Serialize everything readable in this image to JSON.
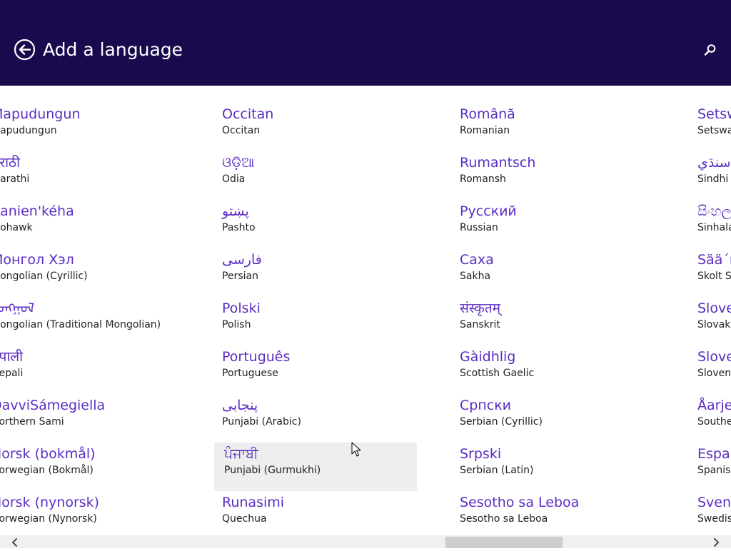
{
  "header": {
    "title": "Add a language",
    "back_icon": "back-arrow-icon",
    "search_icon": "search-icon",
    "background": "#180a4d"
  },
  "accent_color": "#5b2dc3",
  "columns": [
    {
      "items": [
        {
          "native": "Mapudungun",
          "english": "Mapudungun"
        },
        {
          "native": "मराठी",
          "english": "Marathi"
        },
        {
          "native": "Kanien'kéha",
          "english": "Mohawk"
        },
        {
          "native": "Монгол Хэл",
          "english": "Mongolian (Cyrillic)"
        },
        {
          "native": "ᠮᠣᠩᠭᠣᠯ",
          "english": "Mongolian (Traditional Mongolian)"
        },
        {
          "native": "नेपाली",
          "english": "Nepali"
        },
        {
          "native": "DavviSámegiella",
          "english": "Northern Sami"
        },
        {
          "native": "Norsk (bokmål)",
          "english": "Norwegian (Bokmål)"
        },
        {
          "native": "Norsk (nynorsk)",
          "english": "Norwegian (Nynorsk)"
        }
      ]
    },
    {
      "items": [
        {
          "native": "Occitan",
          "english": "Occitan"
        },
        {
          "native": "ଓଡ଼ିଆ",
          "english": "Odia"
        },
        {
          "native": "پښتو",
          "english": "Pashto"
        },
        {
          "native": "فارسى",
          "english": "Persian"
        },
        {
          "native": "Polski",
          "english": "Polish"
        },
        {
          "native": "Português",
          "english": "Portuguese"
        },
        {
          "native": "پنجابی",
          "english": "Punjabi (Arabic)"
        },
        {
          "native": "ਪੰਜਾਬੀ",
          "english": "Punjabi (Gurmukhi)"
        },
        {
          "native": "Runasimi",
          "english": "Quechua"
        }
      ]
    },
    {
      "items": [
        {
          "native": "Română",
          "english": "Romanian"
        },
        {
          "native": "Rumantsch",
          "english": "Romansh"
        },
        {
          "native": "Русский",
          "english": "Russian"
        },
        {
          "native": "Саха",
          "english": "Sakha"
        },
        {
          "native": "संस्कृतम्",
          "english": "Sanskrit"
        },
        {
          "native": "Gàidhlig",
          "english": "Scottish Gaelic"
        },
        {
          "native": "Српски",
          "english": "Serbian (Cyrillic)"
        },
        {
          "native": "Srpski",
          "english": "Serbian (Latin)"
        },
        {
          "native": "Sesotho sa Leboa",
          "english": "Sesotho sa Leboa"
        }
      ]
    },
    {
      "items": [
        {
          "native": "Setswana",
          "english": "Setswana"
        },
        {
          "native": "سنڌي",
          "english": "Sindhi (Arabic)"
        },
        {
          "native": "සිංහල",
          "english": "Sinhala"
        },
        {
          "native": "Sää´mǩiõll",
          "english": "Skolt Sami"
        },
        {
          "native": "Slovenčina",
          "english": "Slovak"
        },
        {
          "native": "Slovenski",
          "english": "Slovenian"
        },
        {
          "native": "Åarjelsaemiengiele",
          "english": "Southern Sami"
        },
        {
          "native": "Español",
          "english": "Spanish"
        },
        {
          "native": "Svenska",
          "english": "Swedish"
        }
      ]
    }
  ],
  "hovered_item": "Punjabi (Gurmukhi)",
  "scrollbar": {
    "left_icon": "chevron-left-icon",
    "right_icon": "chevron-right-icon",
    "position": 0.62
  }
}
